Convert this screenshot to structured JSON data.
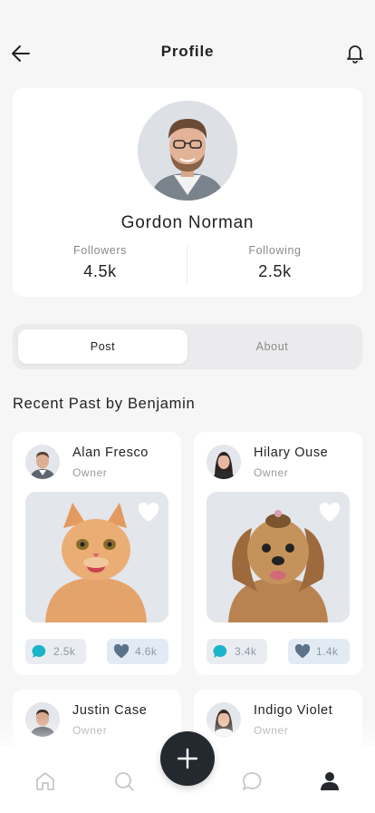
{
  "header": {
    "title": "Profile",
    "back_icon": "arrow-left-icon",
    "bell_icon": "bell-icon"
  },
  "profile": {
    "name": "Gordon Norman",
    "followers_label": "Followers",
    "followers_value": "4.5k",
    "following_label": "Following",
    "following_value": "2.5k"
  },
  "tabs": [
    {
      "label": "Post",
      "active": true
    },
    {
      "label": "About",
      "active": false
    }
  ],
  "section_title": "Recent Past by Benjamin",
  "posts": [
    {
      "author": "Alan Fresco",
      "role": "Owner",
      "image": "cat",
      "comments": "2.5k",
      "likes": "4.6k"
    },
    {
      "author": "Hilary Ouse",
      "role": "Owner",
      "image": "dog",
      "comments": "3.4k",
      "likes": "1.4k"
    },
    {
      "author": "Justin Case",
      "role": "Owner"
    },
    {
      "author": "Indigo Violet",
      "role": "Owner"
    }
  ],
  "bottom_nav": {
    "items": [
      "home-icon",
      "search-icon",
      "add-icon",
      "chat-icon",
      "user-icon"
    ],
    "active": "user-icon"
  },
  "colors": {
    "accent_dark": "#23292e",
    "comment_icon": "#1cb4c9",
    "like_icon": "#5b7288",
    "background": "#f6f6f7"
  }
}
